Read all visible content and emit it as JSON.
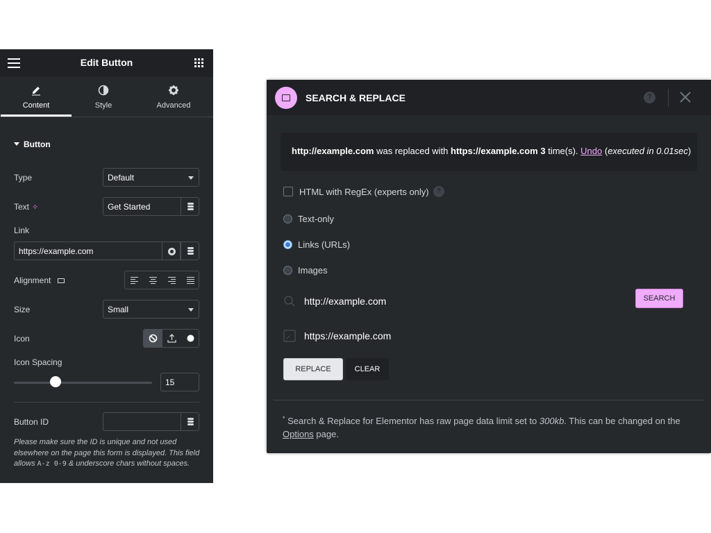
{
  "editor": {
    "title": "Edit Button",
    "tabs": [
      {
        "label": "Content",
        "icon": "pencil-icon",
        "active": true
      },
      {
        "label": "Style",
        "icon": "half-circle-icon",
        "active": false
      },
      {
        "label": "Advanced",
        "icon": "gear-icon",
        "active": false
      }
    ],
    "section_title": "Button",
    "type": {
      "label": "Type",
      "value": "Default"
    },
    "text": {
      "label": "Text",
      "value": "Get Started"
    },
    "link": {
      "label": "Link",
      "value": "https://example.com"
    },
    "alignment": {
      "label": "Alignment",
      "options": [
        "align-left-icon",
        "align-center-icon",
        "align-right-icon",
        "align-justify-icon"
      ]
    },
    "size": {
      "label": "Size",
      "value": "Small"
    },
    "icon": {
      "label": "Icon",
      "options": [
        "none-icon",
        "upload-icon",
        "circle-icon"
      ],
      "selected": "none-icon"
    },
    "icon_spacing": {
      "label": "Icon Spacing",
      "value": "15",
      "slider_fraction": 0.3
    },
    "button_id": {
      "label": "Button ID",
      "value": ""
    },
    "note_parts": {
      "before": "Please make sure the ID is unique and not used elsewhere on the page this form is displayed. This field allows ",
      "code": "A-z 0-9",
      "after": " & underscore chars without spaces."
    }
  },
  "dialog": {
    "title": "SEARCH & REPLACE",
    "help_label": "?",
    "notice": {
      "search": "http://example.com",
      "text1": " was replaced with ",
      "replace": "https://example.com",
      "count": "3",
      "text2": " time(s). ",
      "undo": "Undo",
      "open_paren": " (",
      "executed": "executed in 0.01sec",
      "close_paren": ")"
    },
    "regex_label": "HTML with RegEx (experts only)",
    "regex_help": "?",
    "modes": [
      {
        "label": "Text-only",
        "checked": false
      },
      {
        "label": "Links (URLs)",
        "checked": true
      },
      {
        "label": "Images",
        "checked": false
      }
    ],
    "search_value": "http://example.com",
    "replace_value": "https://example.com",
    "search_button": "SEARCH",
    "replace_button": "REPLACE",
    "clear_button": "CLEAR",
    "footer": {
      "star": "*",
      "text1": " Search & Replace for Elementor has raw page data limit set to ",
      "limit": "300kb",
      "text2": ". This can be changed on the ",
      "options_link": "Options",
      "text3": " page."
    },
    "accent_color": "#f0abfc"
  }
}
